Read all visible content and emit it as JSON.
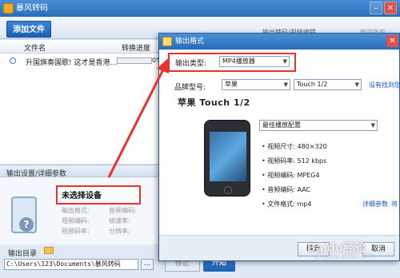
{
  "main_window": {
    "title": "暴风转码",
    "min_glyph": "–",
    "close_glyph": "✕"
  },
  "toolbar": {
    "add_file_label": "添加文件",
    "hint_text": "输出转码/视频编辑",
    "right_text": "删除所有"
  },
  "file_list": {
    "columns": [
      "文件名",
      "转换进度"
    ],
    "rows": [
      {
        "name": "升国旗奏国歌! 这才是香港…",
        "progress_fraction": 0.0,
        "progress_text": "0%"
      }
    ]
  },
  "settings": {
    "title": "输出设置/详细参数",
    "no_device": "未选择设备",
    "specs": [
      {
        "label": "输出格式:"
      },
      {
        "label": "视频编码:"
      },
      {
        "label": "视频码率:"
      },
      {
        "label": "音频编码:"
      },
      {
        "label": "帧速率:"
      },
      {
        "label": "分辨率:"
      }
    ],
    "output_dir_label": "输出目录",
    "output_path": "C:\\Users\\123\\Documents\\暴风转码",
    "browse_label": "...",
    "stop_label": "停止",
    "start_label": "开始"
  },
  "dialog": {
    "title": "输出格式",
    "close_glyph": "✕",
    "type_label": "输出类型:",
    "type_value": "MP4播放器",
    "brand_label": "品牌型号:",
    "brand_value": "苹果",
    "model_value": "Touch 1/2",
    "not_found_link": "没有找到您",
    "device_title": "苹果 Touch 1/2",
    "quality_value": "最佳播放配置",
    "specs": [
      {
        "label": "视频尺寸:",
        "value": "480×320"
      },
      {
        "label": "视频码率:",
        "value": "512 kbps"
      },
      {
        "label": "视频编码:",
        "value": "MPEG4"
      },
      {
        "label": "音频编码:",
        "value": "AAC"
      },
      {
        "label": "文件格式:",
        "value": "mp4"
      }
    ],
    "details_link": "详细参数",
    "details_more": "将",
    "confirm_label": "确定",
    "cancel_label": "取消"
  },
  "watermark": {
    "text": "Baidu经验",
    "sub": "jingyan.baidu.com"
  },
  "colors": {
    "title_bar": "#2a6cb8",
    "highlight_box": "#e8322b",
    "link": "#1a56c8"
  }
}
